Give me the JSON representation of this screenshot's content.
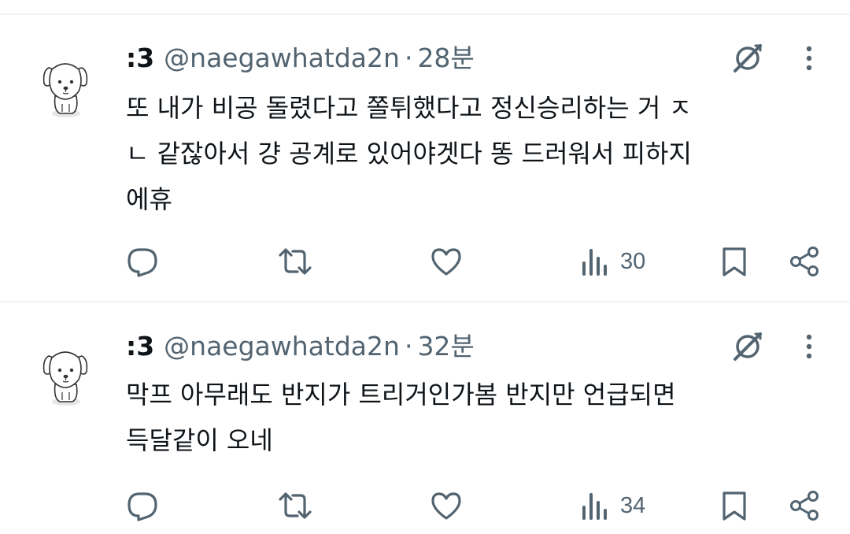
{
  "tweets": [
    {
      "display_name": ":3",
      "handle": "@naegawhatda2n",
      "separator": "·",
      "time": "28분",
      "text": "또 내가 비공 돌렸다고 쫄튀했다고 정신승리하는 거 ㅈ\nㄴ 같잖아서 걍 공계로 있어야겟다 똥 드러워서 피하지\n에휴",
      "views": "30",
      "icons": [
        "grok-icon",
        "more-icon",
        "reply-icon",
        "retweet-icon",
        "like-icon",
        "views-icon",
        "bookmark-icon",
        "share-icon"
      ]
    },
    {
      "display_name": ":3",
      "handle": "@naegawhatda2n",
      "separator": "·",
      "time": "32분",
      "text": "막프 아무래도 반지가 트리거인가봄 반지만 언급되면\n득달같이 오네",
      "views": "34",
      "icons": [
        "grok-icon",
        "more-icon",
        "reply-icon",
        "retweet-icon",
        "like-icon",
        "views-icon",
        "bookmark-icon",
        "share-icon"
      ]
    }
  ],
  "colors": {
    "text": "#0f1419",
    "secondary": "#536471",
    "divider": "#eff3f4"
  }
}
